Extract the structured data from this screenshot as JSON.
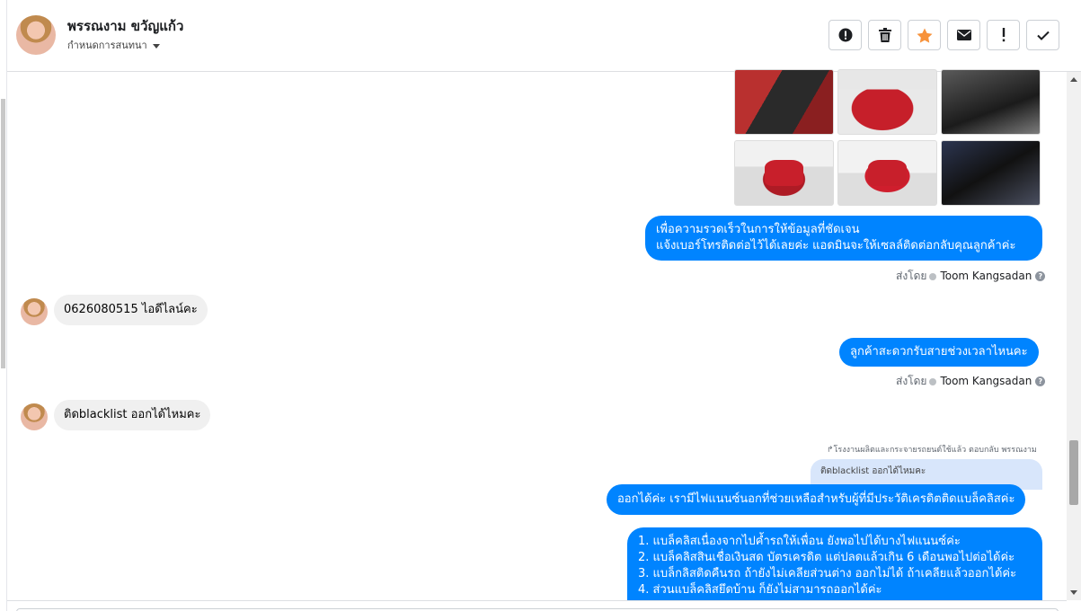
{
  "header": {
    "contact_name": "พรรณงาม ขวัญแก้ว",
    "assign_label": "กำหนดการสนทนา",
    "actions": [
      {
        "icon": "alert-circle-icon"
      },
      {
        "icon": "trash-icon"
      },
      {
        "icon": "star-icon",
        "color": "#f7923a"
      },
      {
        "icon": "envelope-icon"
      },
      {
        "icon": "exclamation-icon"
      },
      {
        "icon": "check-icon"
      }
    ]
  },
  "photos": [
    {
      "name": "car-door-photo"
    },
    {
      "name": "car-front-photo"
    },
    {
      "name": "car-interior-photo"
    },
    {
      "name": "car-side-photo"
    },
    {
      "name": "car-rear-photo"
    },
    {
      "name": "car-seat-photo"
    }
  ],
  "messages": {
    "m1_line1": "เพื่อความรวดเร็วในการให้ข้อมูลที่ชัดเจน",
    "m1_line2": "แจ้งเบอร์โทรติดต่อไว้ได้เลยค่ะ แอดมินจะให้เซลล์ติดต่อกลับคุณลูกค้าค่ะ",
    "sentby_prefix": "ส่งโดย",
    "sentby_name": "Toom Kangsadan",
    "help_glyph": "?",
    "m2_in": "0626080515  ไอดีไลน์คะ",
    "m3_out": "ลูกค้าสะดวกรับสายช่วงเวลาไหนคะ",
    "m4_in": "ติดblacklist ออกได้ไหมคะ",
    "reply_meta": "↱โรงงานผลิตและกระจายรถยนต์ใช้แล้ว ตอบกลับ พรรณงาม",
    "reply_quote": "ติดblacklist ออกได้ไหมคะ",
    "m5_out": "ออกได้ค่ะ เรามีไฟแนนซ์นอกที่ช่วยเหลือสำหรับผู้ที่มีประวัติเครดิตติดแบล็คลิสค่ะ",
    "m6_list": [
      "1. แบล็คลิสเนื่องจากไปค้ำรถให้เพื่อน ยังพอไปได้บางไฟแนนซ์ค่ะ",
      "2. แบล็คลิสสินเชื่อเงินสด บัตรเครดิต แต่ปลดแล้วเกิน 6 เดือนพอไปต่อได้ค่ะ",
      "3. แบล็กลิสติดคืนรถ ถ้ายังไม่เคลียส่วนต่าง ออกไม่ได้ ถ้าเคลียแล้วออกได้ค่ะ",
      "4. ส่วนแบล็คลิสยึดบ้าน ก็ยังไม่สามารถออกได้ค่ะ"
    ]
  },
  "colors": {
    "outgoing_bubble": "#0084ff",
    "incoming_bubble": "#f0f0f0",
    "reply_quote": "#d8e6fb",
    "star": "#f7923a"
  }
}
